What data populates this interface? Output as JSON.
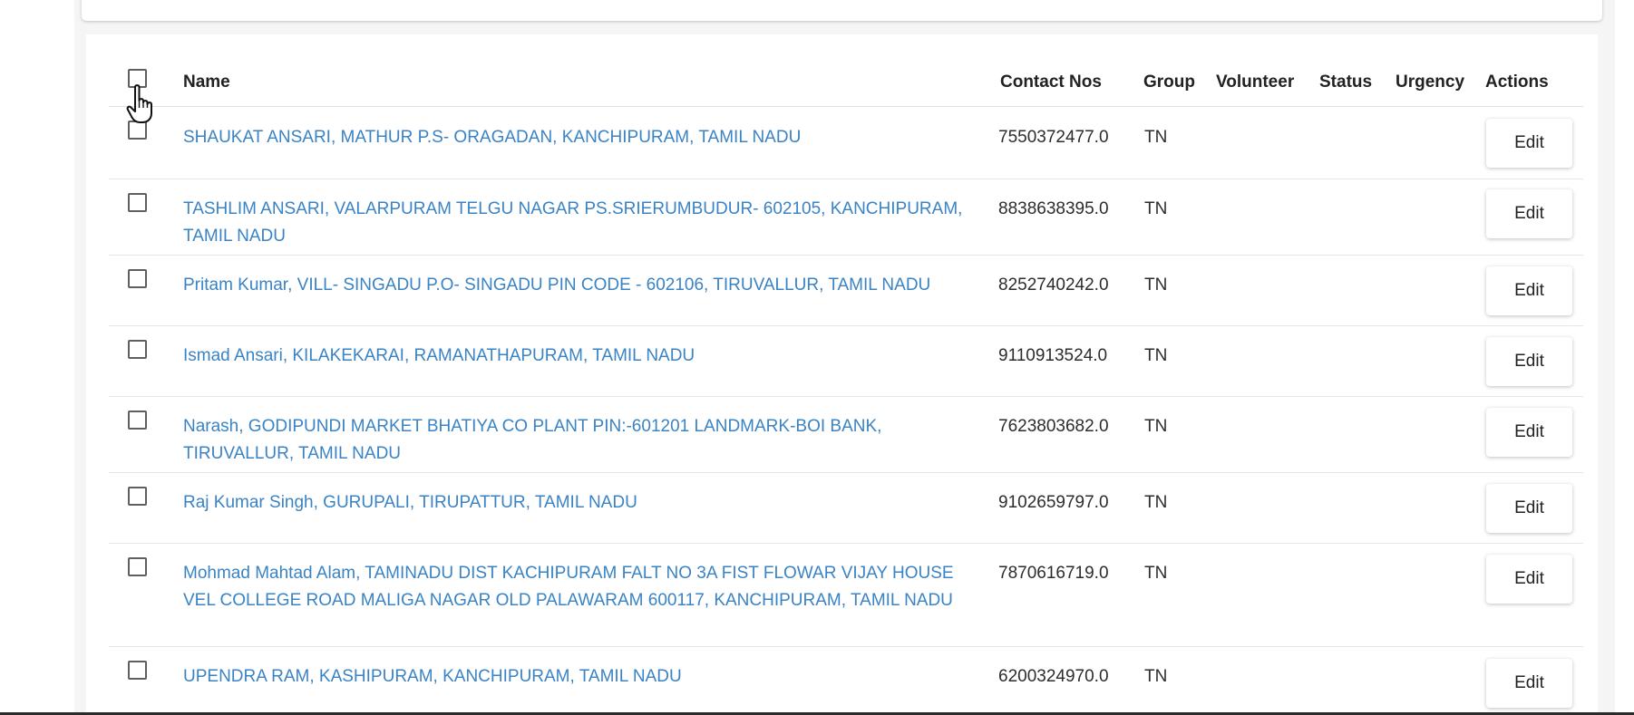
{
  "table": {
    "headers": {
      "name": "Name",
      "contact": "Contact Nos",
      "group": "Group",
      "volunteer": "Volunteer",
      "status": "Status",
      "urgency": "Urgency",
      "actions": "Actions"
    },
    "rows": [
      {
        "name": "SHAUKAT ANSARI, MATHUR P.S- ORAGADAN, KANCHIPURAM, TAMIL NADU",
        "contact": "7550372477.0",
        "group": "TN",
        "action": "Edit"
      },
      {
        "name": "TASHLIM ANSARI, VALARPURAM TELGU NAGAR PS.SRIERUMBUDUR- 602105, KANCHIPURAM, TAMIL NADU",
        "contact": "8838638395.0",
        "group": "TN",
        "action": "Edit"
      },
      {
        "name": "Pritam Kumar, VILL- SINGADU P.O- SINGADU PIN CODE - 602106, TIRUVALLUR, TAMIL NADU",
        "contact": "8252740242.0",
        "group": "TN",
        "action": "Edit"
      },
      {
        "name": "Ismad Ansari, KILAKEKARAI, RAMANATHAPURAM, TAMIL NADU",
        "contact": "9110913524.0",
        "group": "TN",
        "action": "Edit"
      },
      {
        "name": "Narash, GODIPUNDI MARKET BHATIYA CO PLANT PIN:-601201 LANDMARK-BOI BANK, TIRUVALLUR, TAMIL NADU",
        "contact": "7623803682.0",
        "group": "TN",
        "action": "Edit"
      },
      {
        "name": "Raj Kumar Singh, GURUPALI, TIRUPATTUR, TAMIL NADU",
        "contact": "9102659797.0",
        "group": "TN",
        "action": "Edit"
      },
      {
        "name": "Mohmad Mahtad Alam, TAMINADU DIST KACHIPURAM FALT NO 3A FIST FLOWAR VIJAY HOUSE VEL COLLEGE ROAD MALIGA NAGAR OLD PALAWARAM 600117, KANCHIPURAM, TAMIL NADU",
        "contact": "7870616719.0",
        "group": "TN",
        "action": "Edit"
      },
      {
        "name": "UPENDRA RAM, KASHIPURAM, KANCHIPURAM, TAMIL NADU",
        "contact": "6200324970.0",
        "group": "TN",
        "action": "Edit"
      }
    ]
  },
  "icons": {
    "cursor": "hand-pointer-icon"
  }
}
